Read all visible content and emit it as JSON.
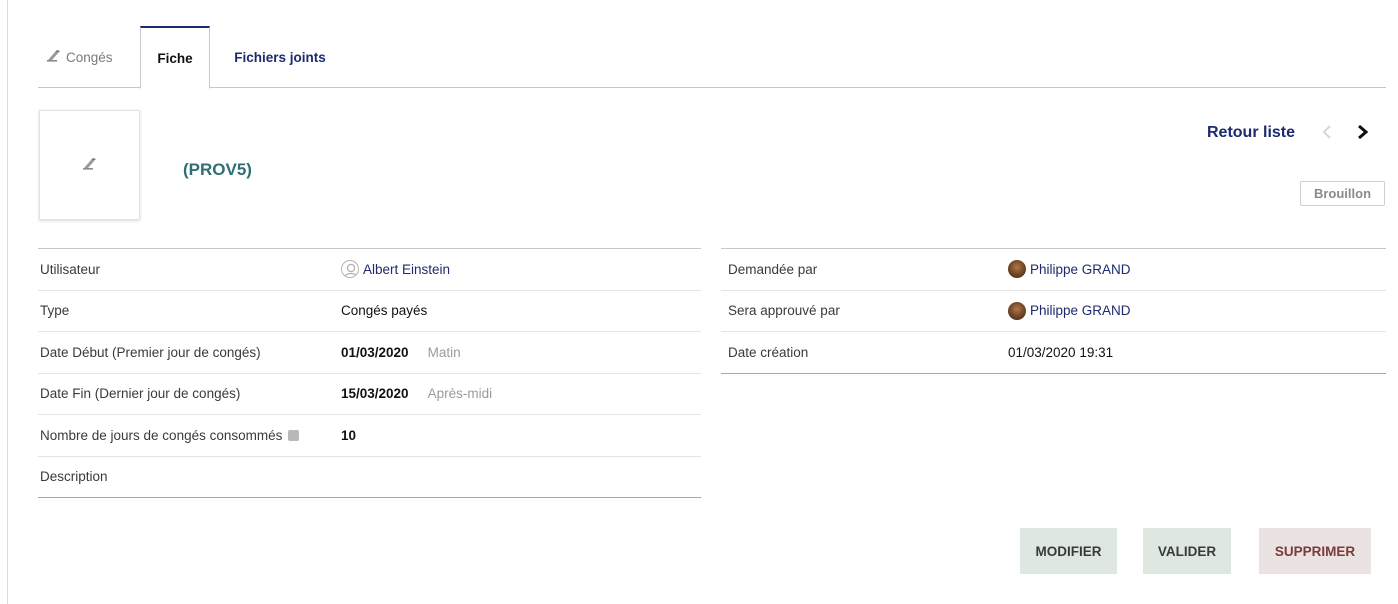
{
  "tabs": [
    {
      "label": "Congés",
      "icon": "leave-icon",
      "active": false
    },
    {
      "label": "Fiche",
      "active": true
    },
    {
      "label": "Fichiers joints",
      "active": false
    }
  ],
  "header": {
    "thumbnail_icon": "leave-icon",
    "ref": "(PROV5)",
    "back_link": "Retour liste",
    "status": "Brouillon"
  },
  "details_left": [
    {
      "label": "Utilisateur",
      "value": "Albert Einstein",
      "avatar": "user-silhouette"
    },
    {
      "label": "Type",
      "value": "Congés payés"
    },
    {
      "label": "Date Début (Premier jour de congés)",
      "date": "01/03/2020",
      "half_day": "Matin"
    },
    {
      "label": "Date Fin (Dernier jour de congés)",
      "date": "15/03/2020",
      "half_day": "Après-midi"
    },
    {
      "label": "Nombre de jours de congés consommés",
      "value": "10"
    },
    {
      "label": "Description",
      "value": ""
    }
  ],
  "details_right": [
    {
      "label": "Demandée par",
      "value": "Philippe GRAND",
      "avatar": "user-photo"
    },
    {
      "label": "Sera approuvé par",
      "value": "Philippe GRAND",
      "avatar": "user-photo"
    },
    {
      "label": "Date création",
      "value": "01/03/2020 19:31"
    }
  ],
  "actions": {
    "modify": "MODIFIER",
    "validate": "VALIDER",
    "delete": "SUPPRIMER"
  },
  "colors": {
    "accent": "#1e2a6e",
    "ref": "#2f6f74",
    "button_bg": "#dfe7e1",
    "delete_bg": "#ebe3e1"
  }
}
